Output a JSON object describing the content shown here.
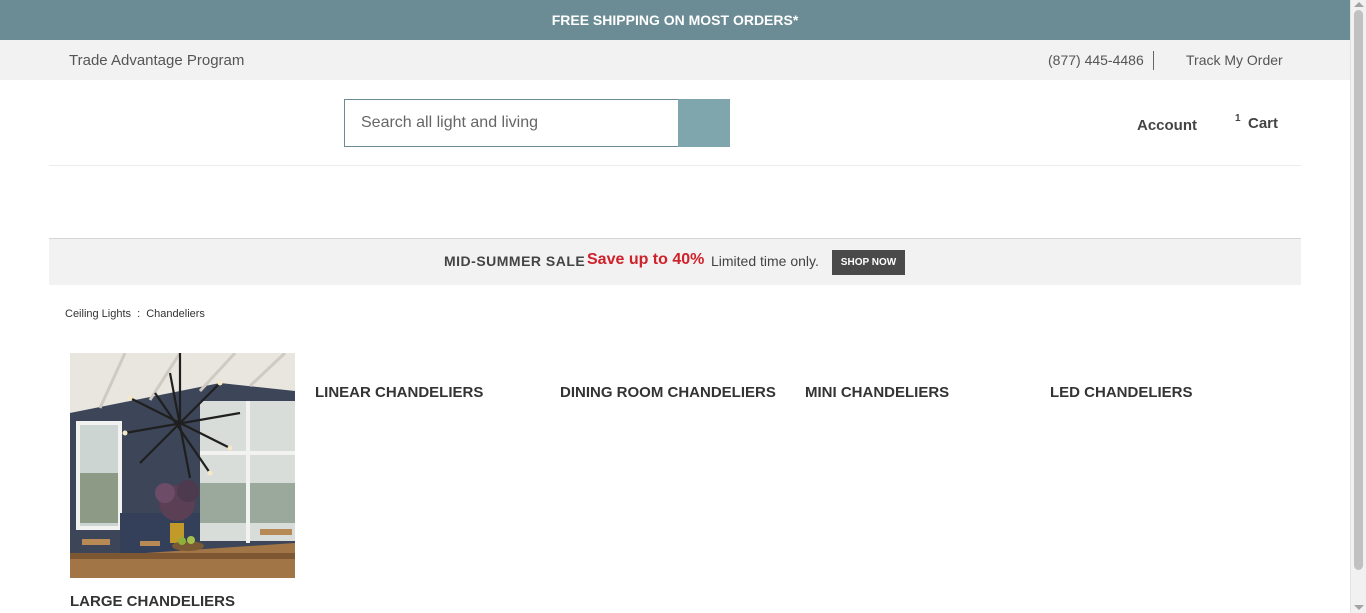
{
  "top_banner": {
    "text": "FREE SHIPPING ON MOST ORDERS*"
  },
  "utility_bar": {
    "trade_link": "Trade Advantage Program",
    "phone": "(877) 445-4486",
    "track_order": "Track My Order"
  },
  "header": {
    "search_placeholder": "Search all light and living",
    "account_label": "Account",
    "cart_count": "1",
    "cart_label": "Cart"
  },
  "promo": {
    "label": "MID-SUMMER SALE",
    "highlight": "Save up to 40%",
    "subtext": "Limited time only.",
    "button": "SHOP NOW"
  },
  "breadcrumb": {
    "parent": "Ceiling Lights",
    "separator": ":",
    "current": "Chandeliers"
  },
  "categories": [
    {
      "title": "LINEAR CHANDELIERS"
    },
    {
      "title": "DINING ROOM CHANDELIERS"
    },
    {
      "title": "MINI CHANDELIERS"
    },
    {
      "title": "LED CHANDELIERS"
    },
    {
      "title": "LARGE CHANDELIERS"
    }
  ],
  "colors": {
    "banner": "#6b8c94",
    "search_button": "#7fa5ad",
    "sale_red": "#d0202a",
    "shop_now_bg": "#4a4a4a"
  }
}
